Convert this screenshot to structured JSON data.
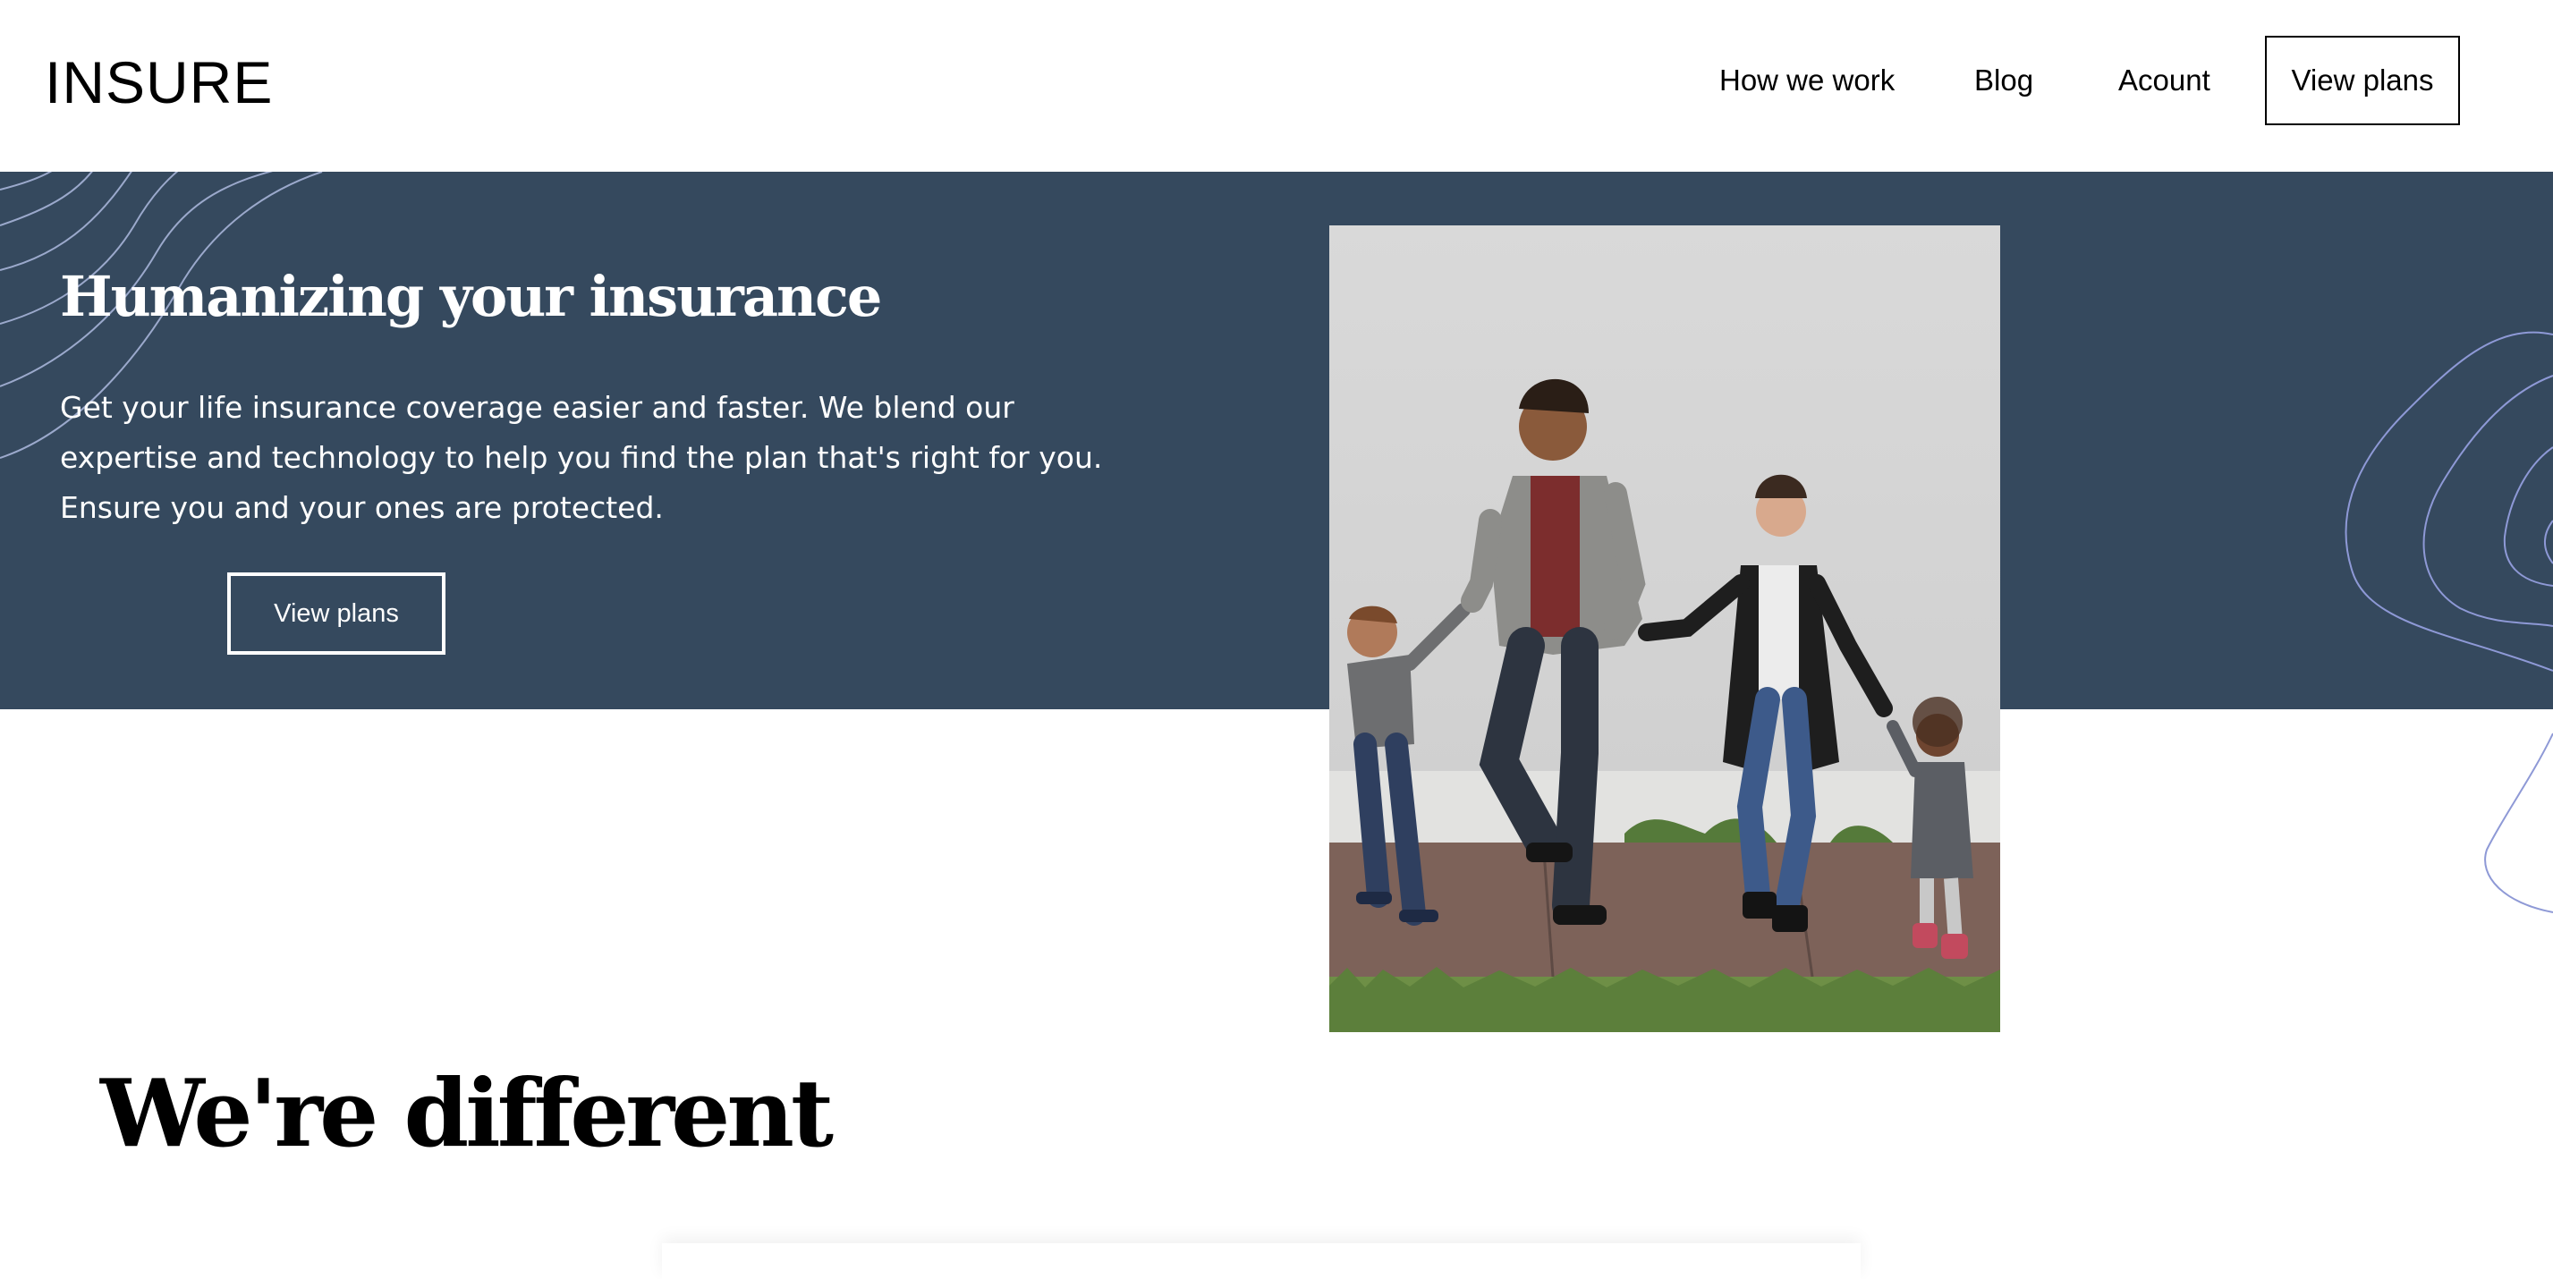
{
  "header": {
    "logo": "INSURE",
    "nav": [
      {
        "label": "How we work"
      },
      {
        "label": "Blog"
      },
      {
        "label": "Acount"
      }
    ],
    "cta_label": "View plans"
  },
  "hero": {
    "title": "Humanizing your insurance",
    "text": "Get your life insurance coverage easier and faster. We blend our expertise and technology to help you find the plan that's right for you. Ensure you and your ones are protected.",
    "cta_label": "View plans",
    "background_color": "#35495e",
    "photo_subject": "family-walking-photo"
  },
  "section": {
    "title": "We're different"
  }
}
